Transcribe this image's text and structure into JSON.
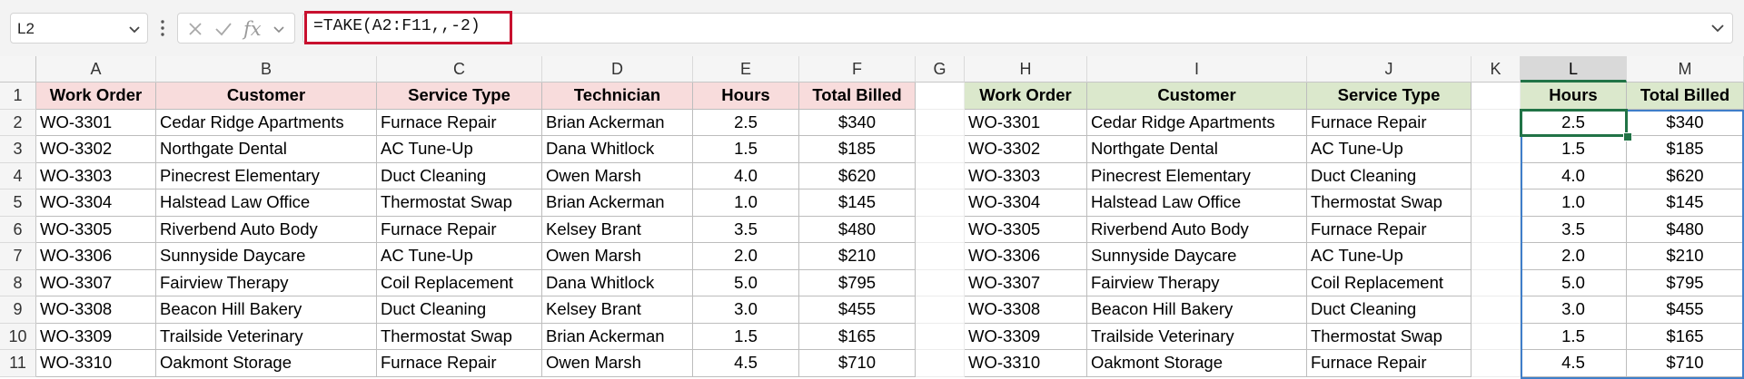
{
  "formula_bar": {
    "name_box": "L2",
    "formula": "=TAKE(A2:F11,,-2)",
    "fx_label": "fx"
  },
  "columns": [
    "A",
    "B",
    "C",
    "D",
    "E",
    "F",
    "G",
    "H",
    "I",
    "J",
    "K",
    "L",
    "M"
  ],
  "selected_column": "L",
  "row_numbers": [
    "1",
    "2",
    "3",
    "4",
    "5",
    "6",
    "7",
    "8",
    "9",
    "10",
    "11"
  ],
  "active_cell": "L2",
  "colors": {
    "source_header_fill": "#f8dcdc",
    "result_header_fill": "#dbe8cc",
    "selection_green": "#217346",
    "formula_highlight": "#c8102e",
    "spill_border": "#3f7ec9"
  },
  "source_table": {
    "headers": [
      "Work Order",
      "Customer",
      "Service Type",
      "Technician",
      "Hours",
      "Total Billed"
    ],
    "rows": [
      [
        "WO-3301",
        "Cedar Ridge Apartments",
        "Furnace Repair",
        "Brian Ackerman",
        "2.5",
        "$340"
      ],
      [
        "WO-3302",
        "Northgate Dental",
        "AC Tune-Up",
        "Dana Whitlock",
        "1.5",
        "$185"
      ],
      [
        "WO-3303",
        "Pinecrest Elementary",
        "Duct Cleaning",
        "Owen Marsh",
        "4.0",
        "$620"
      ],
      [
        "WO-3304",
        "Halstead Law Office",
        "Thermostat Swap",
        "Brian Ackerman",
        "1.0",
        "$145"
      ],
      [
        "WO-3305",
        "Riverbend Auto Body",
        "Furnace Repair",
        "Kelsey Brant",
        "3.5",
        "$480"
      ],
      [
        "WO-3306",
        "Sunnyside Daycare",
        "AC Tune-Up",
        "Owen Marsh",
        "2.0",
        "$210"
      ],
      [
        "WO-3307",
        "Fairview Therapy",
        "Coil Replacement",
        "Dana Whitlock",
        "5.0",
        "$795"
      ],
      [
        "WO-3308",
        "Beacon Hill Bakery",
        "Duct Cleaning",
        "Kelsey Brant",
        "3.0",
        "$455"
      ],
      [
        "WO-3309",
        "Trailside Veterinary",
        "Thermostat Swap",
        "Brian Ackerman",
        "1.5",
        "$165"
      ],
      [
        "WO-3310",
        "Oakmont Storage",
        "Furnace Repair",
        "Owen Marsh",
        "4.5",
        "$710"
      ]
    ]
  },
  "result_table": {
    "headers": [
      "Work Order",
      "Customer",
      "Service Type"
    ],
    "rows": [
      [
        "WO-3301",
        "Cedar Ridge Apartments",
        "Furnace Repair"
      ],
      [
        "WO-3302",
        "Northgate Dental",
        "AC Tune-Up"
      ],
      [
        "WO-3303",
        "Pinecrest Elementary",
        "Duct Cleaning"
      ],
      [
        "WO-3304",
        "Halstead Law Office",
        "Thermostat Swap"
      ],
      [
        "WO-3305",
        "Riverbend Auto Body",
        "Furnace Repair"
      ],
      [
        "WO-3306",
        "Sunnyside Daycare",
        "AC Tune-Up"
      ],
      [
        "WO-3307",
        "Fairview Therapy",
        "Coil Replacement"
      ],
      [
        "WO-3308",
        "Beacon Hill Bakery",
        "Duct Cleaning"
      ],
      [
        "WO-3309",
        "Trailside Veterinary",
        "Thermostat Swap"
      ],
      [
        "WO-3310",
        "Oakmont Storage",
        "Furnace Repair"
      ]
    ]
  },
  "spill_table": {
    "headers": [
      "Hours",
      "Total Billed"
    ],
    "rows": [
      [
        "2.5",
        "$340"
      ],
      [
        "1.5",
        "$185"
      ],
      [
        "4.0",
        "$620"
      ],
      [
        "1.0",
        "$145"
      ],
      [
        "3.5",
        "$480"
      ],
      [
        "2.0",
        "$210"
      ],
      [
        "5.0",
        "$795"
      ],
      [
        "3.0",
        "$455"
      ],
      [
        "1.5",
        "$165"
      ],
      [
        "4.5",
        "$710"
      ]
    ]
  }
}
